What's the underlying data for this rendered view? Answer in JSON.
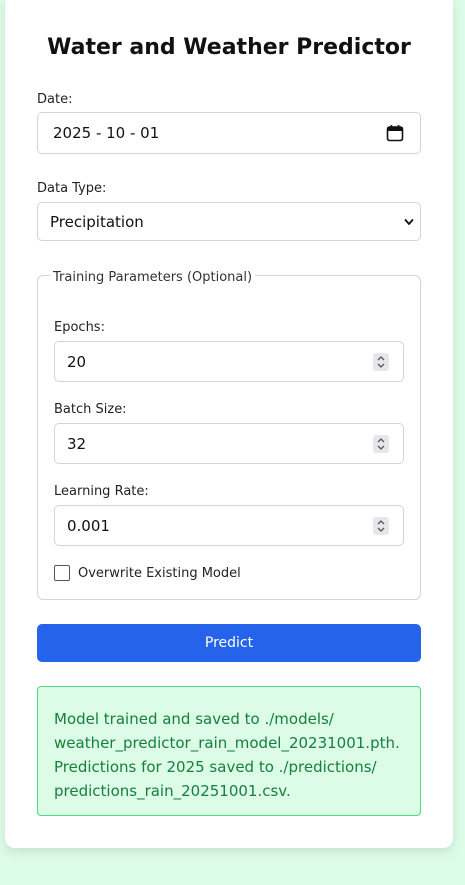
{
  "page": {
    "title": "Water and Weather Predictor"
  },
  "form": {
    "date_label": "Date:",
    "date_value": "2025 - 10 - 01",
    "data_type_label": "Data Type:",
    "data_type_value": "Precipitation",
    "training": {
      "legend": "Training Parameters (Optional)",
      "epochs_label": "Epochs:",
      "epochs_value": "20",
      "batch_size_label": "Batch Size:",
      "batch_size_value": "32",
      "learning_rate_label": "Learning Rate:",
      "learning_rate_value": "0.001",
      "overwrite_label": "Overwrite Existing Model",
      "overwrite_checked": false
    },
    "predict_label": "Predict"
  },
  "result": {
    "lines": [
      "Model trained and saved to ./models/",
      "weather_predictor_rain_model_20231001.pth.",
      "Predictions for 2025 saved to ./predictions/",
      "predictions_rain_20251001.csv."
    ]
  },
  "icons": {
    "date": "calendar-icon",
    "select": "chevron-down-icon",
    "number": "spinner-icon"
  },
  "colors": {
    "background": "#dcfce7",
    "button": "#2563eb",
    "success_bg": "#dcfce7",
    "success_border": "#4ade80",
    "success_text": "#15803d"
  }
}
